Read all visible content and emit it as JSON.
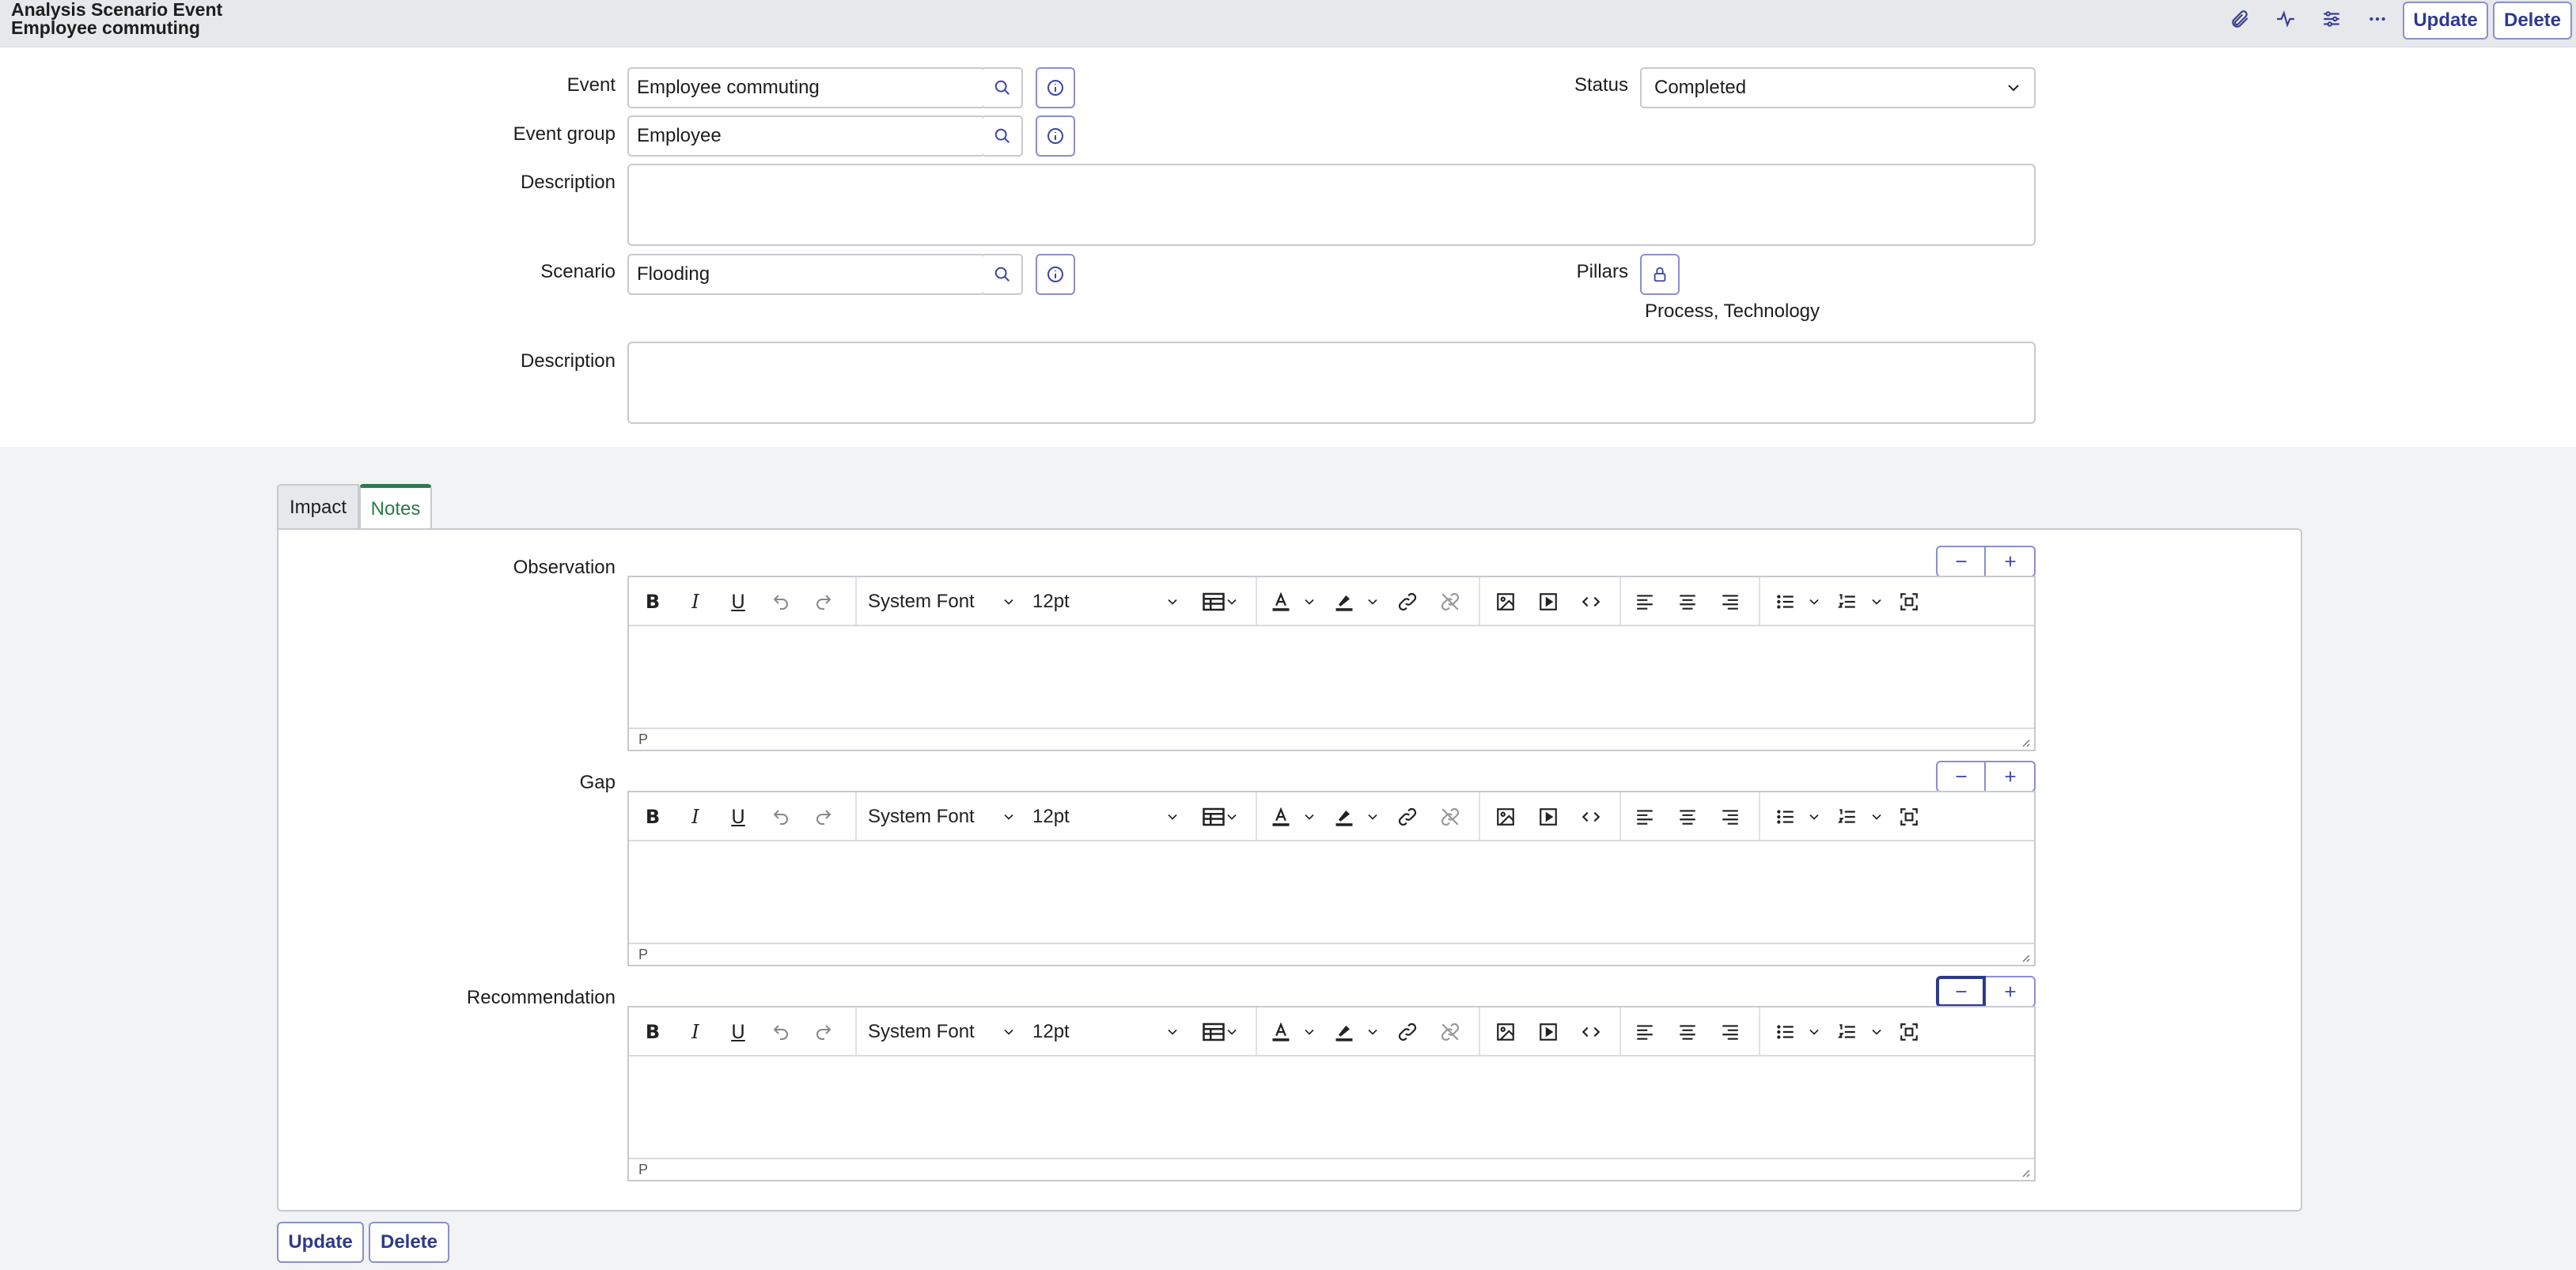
{
  "header": {
    "title": "Analysis Scenario Event",
    "subtitle": "Employee commuting",
    "icons": [
      "paperclip-icon",
      "activity-icon",
      "sliders-icon",
      "more-icon"
    ],
    "update_label": "Update",
    "delete_label": "Delete"
  },
  "form": {
    "event_label": "Event",
    "event_value": "Employee commuting",
    "event_group_label": "Event group",
    "event_group_value": "Employee",
    "description_label": "Description",
    "scenario_label": "Scenario",
    "scenario_value": "Flooding",
    "description2_label": "Description",
    "status_label": "Status",
    "status_value": "Completed",
    "pillars_label": "Pillars",
    "pillars_value": "Process, Technology"
  },
  "tabs": [
    {
      "label": "Impact"
    },
    {
      "label": "Notes"
    }
  ],
  "notes": {
    "editors": [
      {
        "label": "Observation",
        "font": "System Font",
        "size": "12pt",
        "status": "P"
      },
      {
        "label": "Gap",
        "font": "System Font",
        "size": "12pt",
        "status": "P"
      },
      {
        "label": "Recommendation",
        "font": "System Font",
        "size": "12pt",
        "status": "P"
      }
    ]
  },
  "footer": {
    "update_label": "Update",
    "delete_label": "Delete"
  },
  "colors": {
    "accent": "#2e3a8c",
    "tab_active": "#2d7a4a",
    "border": "#c7cacf"
  }
}
